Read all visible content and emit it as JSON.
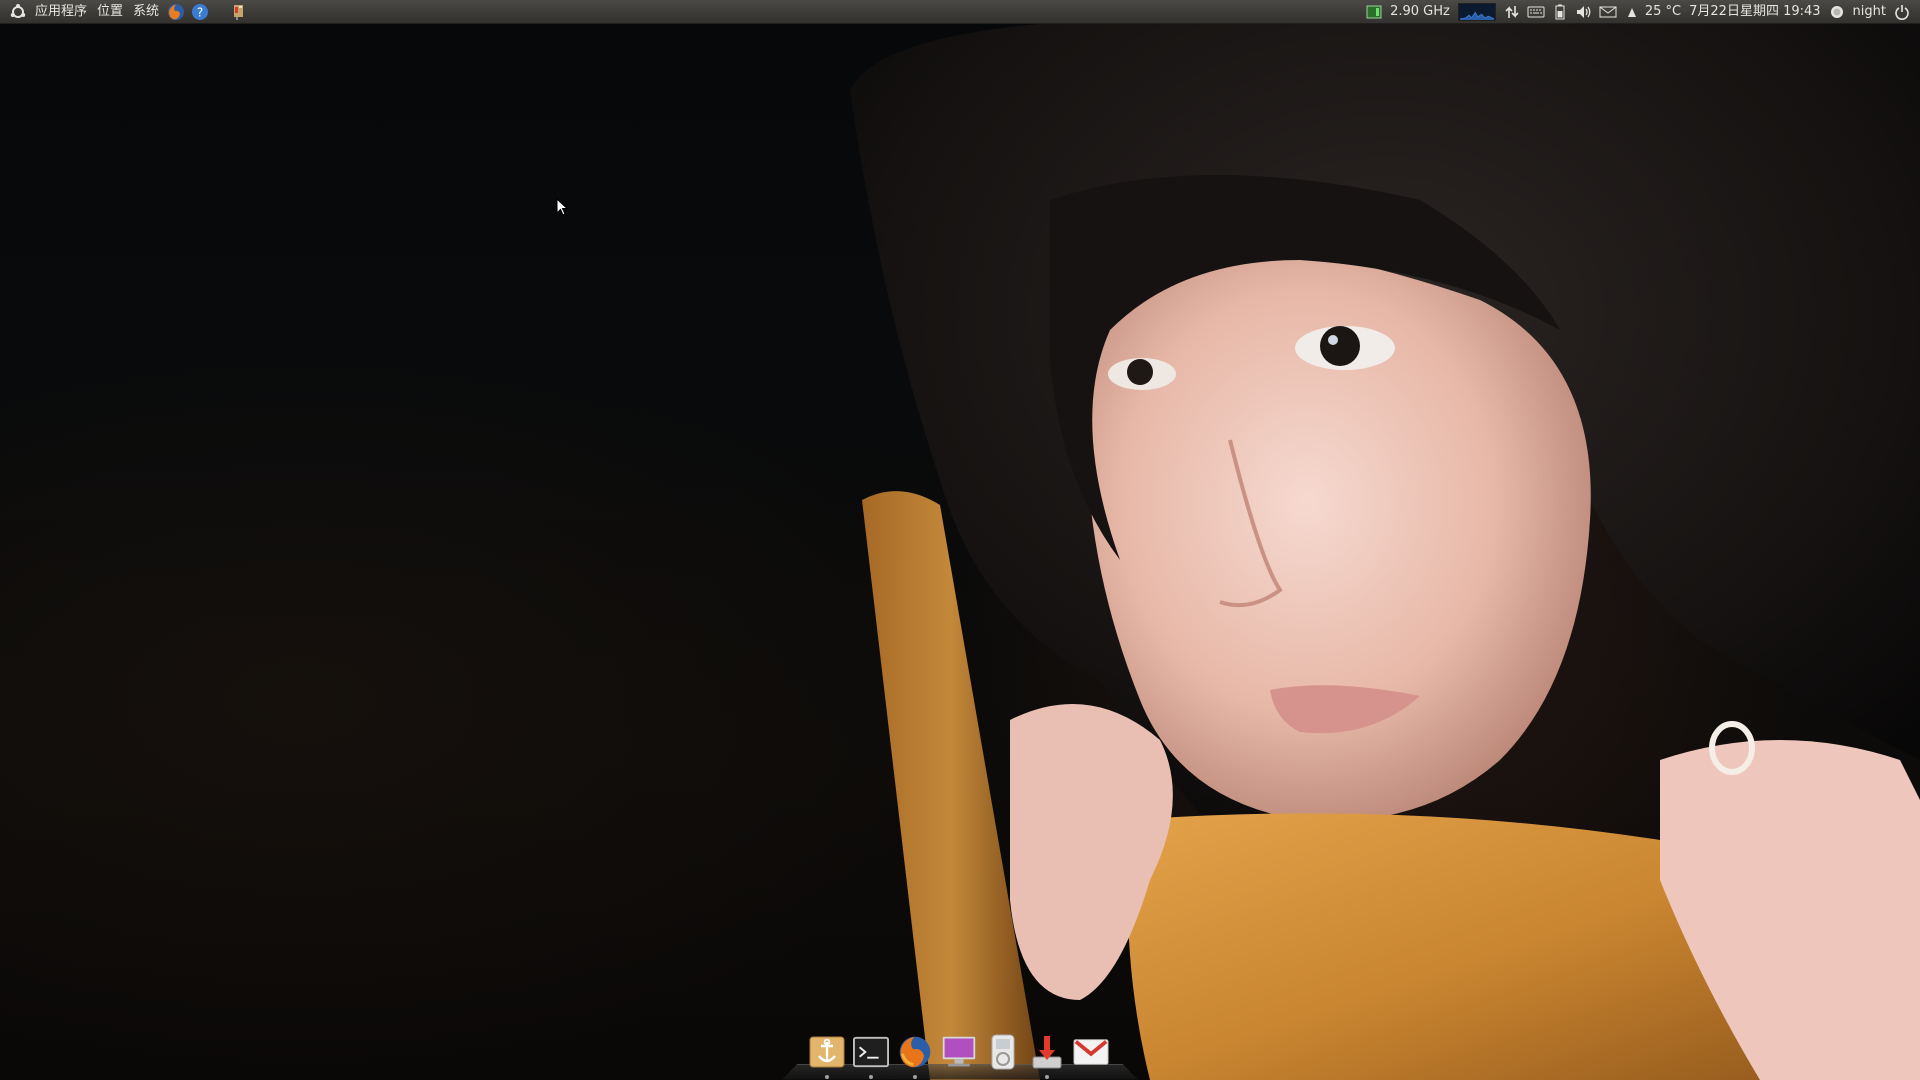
{
  "top_panel": {
    "menus": {
      "applications": "应用程序",
      "places": "位置",
      "system": "系统"
    },
    "launchers": [
      {
        "name": "firefox",
        "icon": "firefox-icon"
      },
      {
        "name": "help",
        "icon": "help-icon"
      },
      {
        "name": "tool",
        "icon": "flash-tool-icon"
      }
    ],
    "indicators": {
      "cpu_freq": "2.90 GHz",
      "temperature": "25 °C",
      "clock": "7月22日星期四 19:43",
      "user": "night"
    }
  },
  "dock": {
    "items": [
      {
        "name": "dock-settings",
        "icon": "anchor-icon"
      },
      {
        "name": "terminal",
        "icon": "terminal-icon"
      },
      {
        "name": "firefox",
        "icon": "firefox-icon"
      },
      {
        "name": "display",
        "icon": "monitor-icon"
      },
      {
        "name": "media-player",
        "icon": "ipod-icon"
      },
      {
        "name": "downloader",
        "icon": "download-icon"
      },
      {
        "name": "gmail",
        "icon": "gmail-icon"
      }
    ]
  },
  "colors": {
    "panel": "#3c3b37",
    "panel_text": "#e8e6e0",
    "desktop_dark": "#06080a",
    "chair_wood": "#c9872e"
  }
}
